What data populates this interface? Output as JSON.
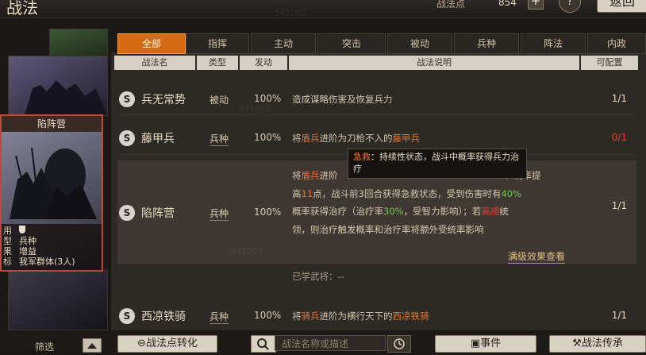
{
  "header": {
    "title": "战法",
    "points_label": "战法点",
    "points_value": "854",
    "plus": "+",
    "help": "?",
    "back": "返回"
  },
  "tabs": [
    "全部",
    "指挥",
    "主动",
    "突击",
    "被动",
    "兵种",
    "阵法",
    "内政"
  ],
  "columns": [
    "战法名",
    "类型",
    "发动",
    "战法说明",
    "可配置"
  ],
  "card": {
    "name": "陷阵营",
    "info_labels": [
      "用",
      "型",
      "果",
      "标"
    ],
    "info_values": [
      "",
      "兵种",
      "增益",
      "我军群体(3人)"
    ]
  },
  "rows": [
    {
      "icon": "S",
      "name": "兵无常势",
      "type": "被动",
      "rate": "100%",
      "desc": "造成谋略伤害及恢复兵力",
      "count": "1/1"
    },
    {
      "icon": "S",
      "name": "藤甲兵",
      "type": "兵种",
      "rate": "100%",
      "desc_a": "将",
      "desc_b": "盾兵",
      "desc_c": "进阶为刀枪不入的",
      "desc_d": "藤甲兵",
      "count": "0/1"
    },
    {
      "icon": "S",
      "name": "陷阵营",
      "type": "兵种",
      "rate": "100%",
      "count": "1/1"
    },
    {
      "icon": "S",
      "name": "西凉铁骑",
      "type": "兵种",
      "rate": "100%",
      "desc_a": "将",
      "desc_b": "骑兵",
      "desc_c": "进阶为横行天下的",
      "desc_d": "西凉铁骑",
      "count": "1/1"
    }
  ],
  "selected": {
    "line1_a": "将",
    "line1_b": "盾兵",
    "line1_c": "进阶",
    "line1_d": "、统率提",
    "line2_a": "高",
    "line2_b": "11",
    "line2_c": "点，战斗前3回合获得急救状态，受到伤害时有",
    "line2_d": "40%",
    "line3_a": "概率获得治疗（治疗率",
    "line3_b": "30%",
    "line3_c": "，受智力影响）；若",
    "line3_d": "高顺",
    "line3_e": "统",
    "line4": "领，则治疗触发概率和治疗率将额外受统率影响",
    "more": "满级效果查看",
    "learned": "已学武将：--"
  },
  "tooltip": {
    "key": "急救",
    "text": "：持续性状态，战斗中概率获得兵力治疗"
  },
  "bottom": {
    "filter": "筛选",
    "convert": "战法点转化",
    "search_placeholder": "战法名称或描述",
    "event": "事件",
    "inherit": "战法传承"
  },
  "watermark": "341002",
  "colors": {
    "accent": "#d46a14",
    "red": "#d94436",
    "orange": "#e07832",
    "green": "#73c255"
  }
}
